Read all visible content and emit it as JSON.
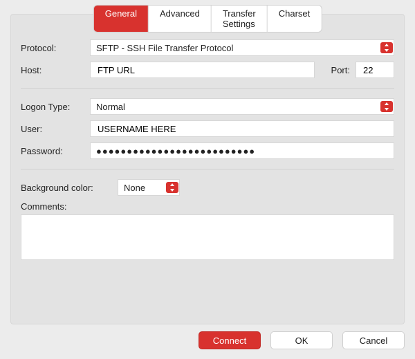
{
  "tabs": {
    "general": "General",
    "advanced": "Advanced",
    "transfer": "Transfer Settings",
    "charset": "Charset"
  },
  "labels": {
    "protocol": "Protocol:",
    "host": "Host:",
    "port": "Port:",
    "logonType": "Logon Type:",
    "user": "User:",
    "password": "Password:",
    "bgcolor": "Background color:",
    "comments": "Comments:"
  },
  "values": {
    "protocol": "SFTP - SSH File Transfer Protocol",
    "host": "FTP URL",
    "port": "22",
    "logonType": "Normal",
    "user": "USERNAME HERE",
    "password": "●●●●●●●●●●●●●●●●●●●●●●●●●●",
    "bgcolor": "None",
    "comments": ""
  },
  "buttons": {
    "connect": "Connect",
    "ok": "OK",
    "cancel": "Cancel"
  },
  "colors": {
    "accent": "#d8322e"
  }
}
